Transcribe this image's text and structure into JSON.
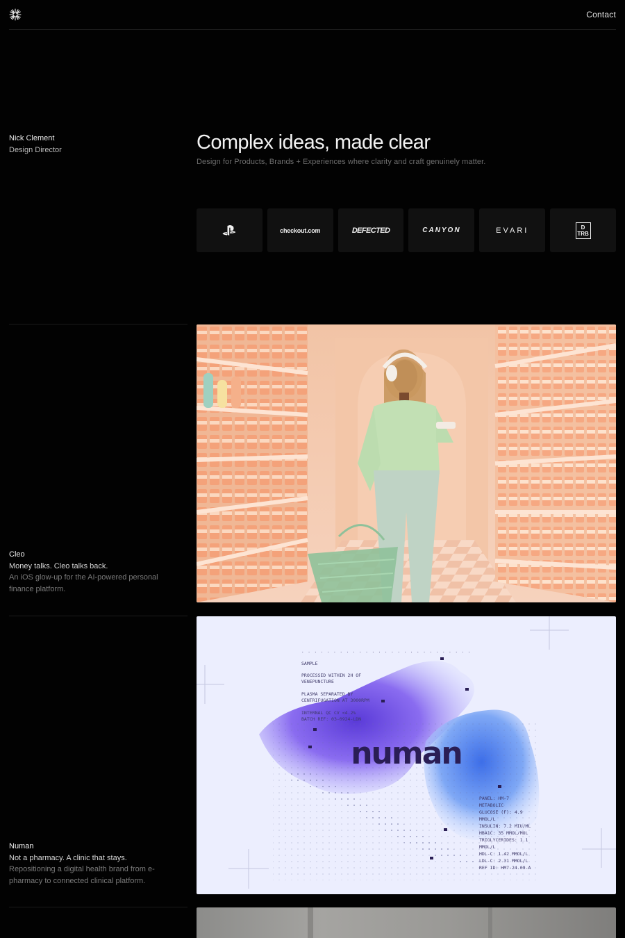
{
  "header": {
    "logo_icon": "starburst-icon",
    "contact_label": "Contact"
  },
  "person": {
    "name": "Nick Clement",
    "role": "Design Director"
  },
  "hero": {
    "headline": "Complex ideas, made clear",
    "subheadline": "Design for Products, Brands + Experiences where clarity and craft genuinely matter."
  },
  "clients": [
    {
      "icon": "playstation-logo"
    },
    {
      "name": "checkout.com"
    },
    {
      "name": "DEFECTED"
    },
    {
      "name": "CANYON"
    },
    {
      "name": "EVARI"
    },
    {
      "name": "D TRB"
    }
  ],
  "projects": [
    {
      "name": "Cleo",
      "tagline": "Money talks. Cleo talks back.",
      "description": "An iOS glow-up for the AI-powered personal finance platform."
    },
    {
      "name": "Numan",
      "tagline": "Not a pharmacy. A clinic that stays.",
      "description": "Repositioning a digital health brand from e-pharmacy to connected clinical platform.",
      "image_text": {
        "brand": "numan",
        "left_block": [
          "SAMPLE",
          "PROCESSED WITHIN 2H OF",
          "VENEPUNCTURE",
          "PLASMA SEPARATED BY",
          "CENTRIFUGATION AT 3000RPM",
          "INTERNAL QC CV <4.2%",
          "BATCH REF: 03-0924-LDN"
        ],
        "right_block": [
          "PANEL: HM-7",
          "METABOLIC",
          "GLUCOSE (F): 4.9",
          "MMOL/L",
          "INSULIN: 7.2 MIU/ML",
          "HBA1C: 35 MMOL/MOL",
          "TRIGLYCERIDES: 1.1",
          "MMOL/L",
          "HDL-C: 1.42 MMOL/L",
          "LDL-C: 2.31 MMOL/L",
          "REF ID: HM7-24.09-A"
        ]
      }
    }
  ]
}
